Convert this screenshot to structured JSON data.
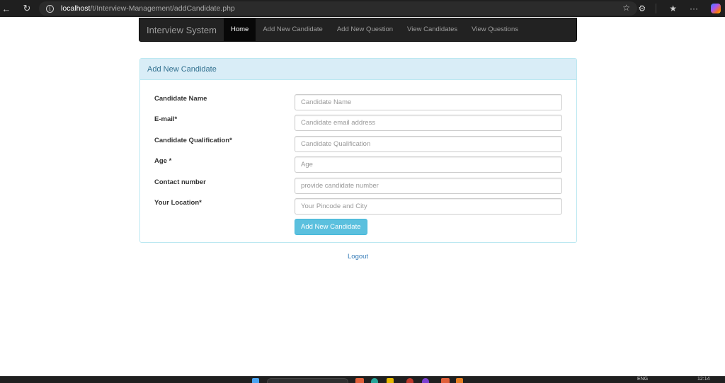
{
  "browser": {
    "url_host": "localhost",
    "url_path": "/t/Interview-Management/addCandidate.php",
    "icons": {
      "back": "back-arrow-icon",
      "reload": "reload-icon",
      "info": "site-info-icon",
      "favorite": "star-icon",
      "extensions": "extensions-icon",
      "favorites": "favorites-icon",
      "more": "more-icon",
      "copilot": "copilot-icon"
    },
    "more_label": "···",
    "info_label": "i"
  },
  "navbar": {
    "brand": "Interview System",
    "items": [
      {
        "label": "Home",
        "active": true
      },
      {
        "label": "Add New Candidate",
        "active": false
      },
      {
        "label": "Add New Question",
        "active": false
      },
      {
        "label": "View Candidates",
        "active": false
      },
      {
        "label": "View Questions",
        "active": false
      }
    ]
  },
  "panel": {
    "title": "Add New Candidate",
    "fields": [
      {
        "label": "Candidate Name",
        "placeholder": "Candidate Name",
        "value": ""
      },
      {
        "label": "E-mail*",
        "placeholder": "Candidate email address",
        "value": ""
      },
      {
        "label": "Candidate Qualification*",
        "placeholder": "Candidate Qualification",
        "value": ""
      },
      {
        "label": "Age *",
        "placeholder": "Age",
        "value": ""
      },
      {
        "label": "Contact number",
        "placeholder": "provide candidate number",
        "value": ""
      },
      {
        "label": "Your Location*",
        "placeholder": "Your Pincode and City",
        "value": ""
      }
    ],
    "submit_label": "Add New Candidate"
  },
  "logout_label": "Logout",
  "taskbar": {
    "language": "ENG",
    "time": "12:14"
  },
  "colors": {
    "navbar_bg": "#222222",
    "navbar_active_bg": "#080808",
    "panel_heading_bg": "#d9edf7",
    "panel_heading_text": "#31708f",
    "panel_border": "#bce8f1",
    "button_info": "#5bc0de",
    "link": "#337ab7"
  }
}
